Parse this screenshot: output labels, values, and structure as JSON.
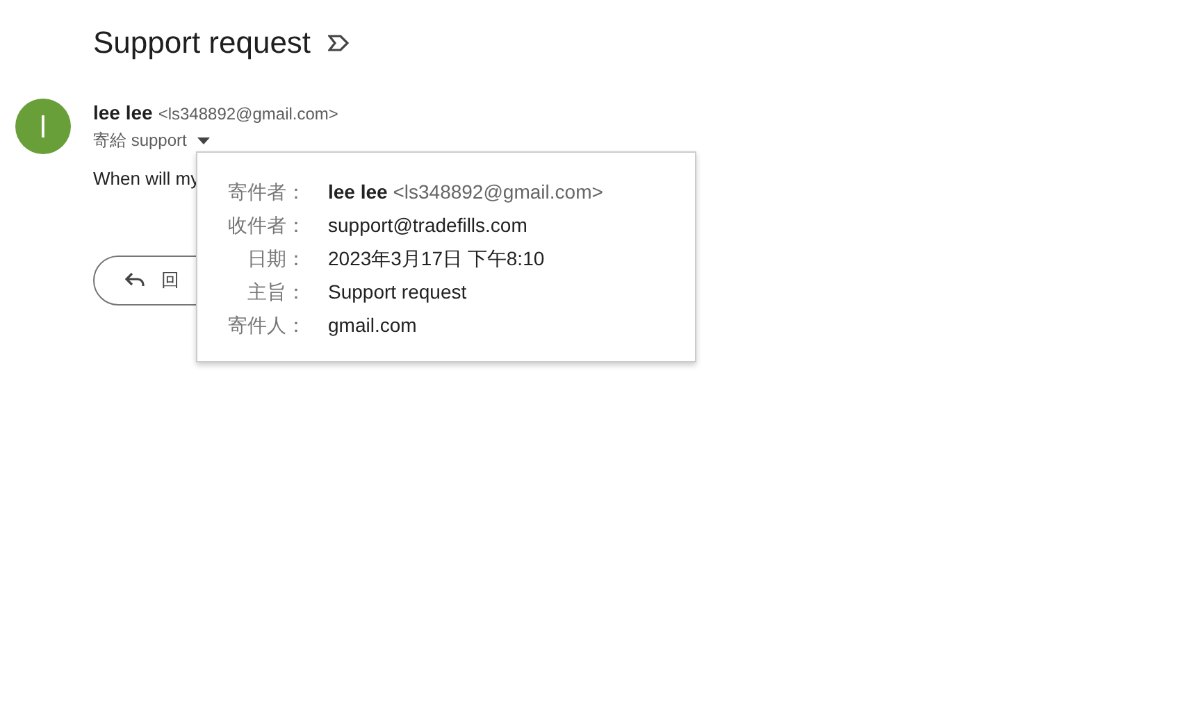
{
  "subject": "Support request",
  "sender": {
    "avatar": "l",
    "name": "lee lee",
    "email": "<ls348892@gmail.com>",
    "to": "寄給 support"
  },
  "body": "When will my",
  "reply_button": {
    "label": "回"
  },
  "details_popup": {
    "rows": [
      {
        "label": "寄件者：",
        "name": "lee lee",
        "value": "<ls348892@gmail.com>"
      },
      {
        "label": "收件者：",
        "value": "support@tradefills.com"
      },
      {
        "label": "日期：",
        "value": "2023年3月17日 下午8:10"
      },
      {
        "label": "主旨：",
        "value": "Support request"
      },
      {
        "label": "寄件人：",
        "value": "gmail.com"
      }
    ]
  }
}
